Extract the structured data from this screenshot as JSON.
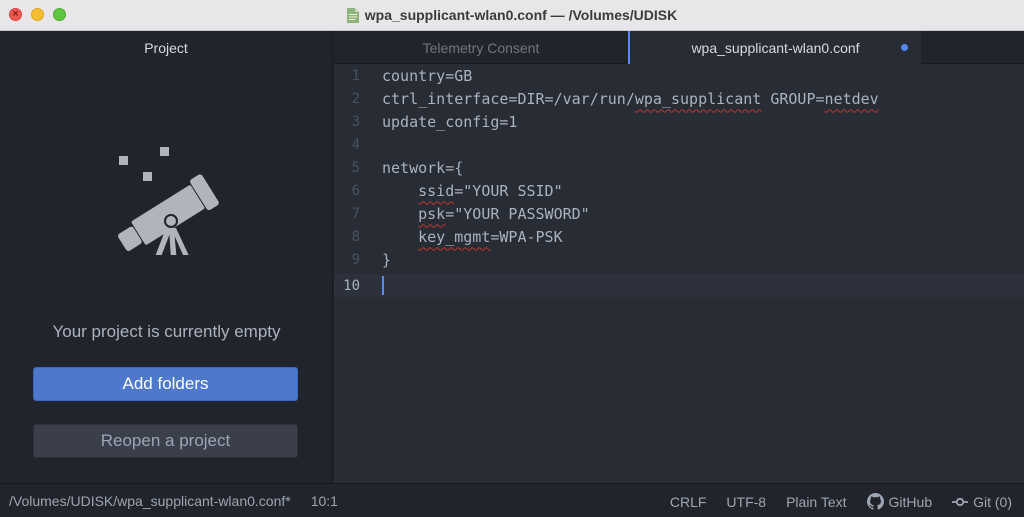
{
  "window": {
    "title": "wpa_supplicant-wlan0.conf — /Volumes/UDISK",
    "close_glyph": "×"
  },
  "sidebar": {
    "title": "Project",
    "empty_message": "Your project is currently empty",
    "add_folders_label": "Add folders",
    "reopen_label": "Reopen a project",
    "icon": "telescope-icon"
  },
  "tabs": [
    {
      "label": "Telemetry Consent",
      "active": false
    },
    {
      "label": "wpa_supplicant-wlan0.conf",
      "active": true,
      "modified": true
    }
  ],
  "editor": {
    "lines": [
      {
        "num": "1",
        "text": "country=GB"
      },
      {
        "num": "2",
        "text": "ctrl_interface=DIR=/var/run/wpa_supplicant GROUP=netdev"
      },
      {
        "num": "3",
        "text": "update_config=1"
      },
      {
        "num": "4",
        "text": ""
      },
      {
        "num": "5",
        "text": "network={"
      },
      {
        "num": "6",
        "text": "    ssid=\"YOUR SSID\""
      },
      {
        "num": "7",
        "text": "    psk=\"YOUR PASSWORD\""
      },
      {
        "num": "8",
        "text": "    key_mgmt=WPA-PSK"
      },
      {
        "num": "9",
        "text": "}"
      },
      {
        "num": "10",
        "text": ""
      }
    ],
    "current_line": "10"
  },
  "statusbar": {
    "file_path": "/Volumes/UDISK/wpa_supplicant-wlan0.conf*",
    "cursor_position": "10:1",
    "line_ending": "CRLF",
    "encoding": "UTF-8",
    "grammar": "Plain Text",
    "github_label": "GitHub",
    "git_label": "Git (0)"
  },
  "colors": {
    "accent": "#568af2",
    "button_primary": "#4d78cc",
    "editor_bg": "#282c34",
    "panel_bg": "#21252b",
    "spell_underline": "#c0392b"
  }
}
